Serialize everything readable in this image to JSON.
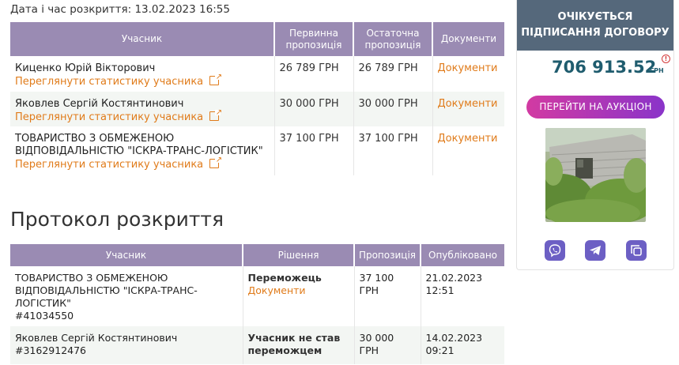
{
  "opening_date": "Дата і час розкриття: 13.02.2023 16:55",
  "bids_table": {
    "headers": [
      "Учасник",
      "Первинна пропозиція",
      "Остаточна пропозиція",
      "Документи"
    ],
    "rows": [
      {
        "name": "Киценко Юрій Вікторович",
        "stats_link": "Переглянути статистику учасника",
        "initial": "26 789 ГРН",
        "final": "26 789 ГРН",
        "docs": "Документи"
      },
      {
        "name": "Яковлев Сергій Костянтинович",
        "stats_link": "Переглянути статистику учасника",
        "initial": "30 000 ГРН",
        "final": "30 000 ГРН",
        "docs": "Документи"
      },
      {
        "name": "ТОВАРИСТВО З ОБМЕЖЕНОЮ ВІДПОВІДАЛЬНІСТЮ \"ІСКРА-ТРАНС-ЛОГІСТИК\"",
        "stats_link": "Переглянути статистику учасника",
        "initial": "37 100 ГРН",
        "final": "37 100 ГРН",
        "docs": "Документи"
      }
    ]
  },
  "protocol": {
    "title": "Протокол розкриття",
    "headers": [
      "Учасник",
      "Рішення",
      "Пропозиція",
      "Опубліковано"
    ],
    "rows": [
      {
        "name": "ТОВАРИСТВО З ОБМЕЖЕНОЮ ВІДПОВІДАЛЬНІСТЮ \"ІСКРА-ТРАНС-ЛОГІСТИК\"",
        "id": "#41034550",
        "decision": "Переможець",
        "docs": "Документи",
        "offer": "37 100 ГРН",
        "date": "21.02.2023",
        "time": "12:51"
      },
      {
        "name": "Яковлев Сергій Костянтинович",
        "id": "#3162912476",
        "decision": "Учасник не став переможцем",
        "offer": "30 000 ГРН",
        "date": "14.02.2023",
        "time": "09:21"
      }
    ]
  },
  "sidebar": {
    "status": "ОЧІКУЄТЬСЯ ПІДПИСАННЯ ДОГОВОРУ",
    "amount": "706 913.52",
    "currency": "ГРН",
    "info_symbol": "!",
    "auction_button": "ПЕРЕЙТИ НА АУКЦІОН"
  },
  "icons": [
    "external-link-icon",
    "info-icon",
    "viber-icon",
    "telegram-icon",
    "copy-icon"
  ],
  "colors": {
    "header": "#9a8bb3",
    "link": "#e07b1a",
    "status_bg": "#55687b",
    "amount": "#1f5c6e",
    "share": "#6c5fc4"
  }
}
